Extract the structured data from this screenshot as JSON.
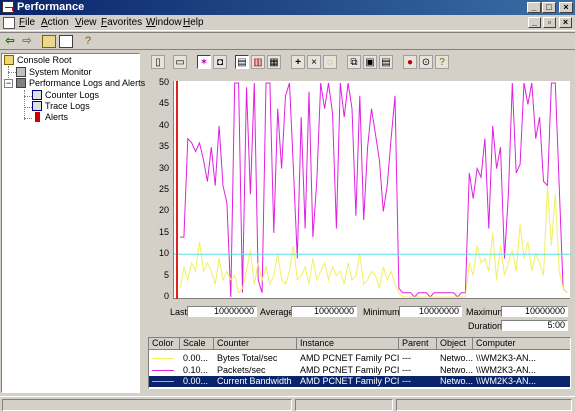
{
  "window": {
    "title": "Performance"
  },
  "menu": [
    "File",
    "Action",
    "View",
    "Favorites",
    "Window",
    "Help"
  ],
  "toolbar_icons": [
    "back-icon",
    "forward-icon",
    "up-folder-icon",
    "show-hide-tree-icon",
    "help-icon"
  ],
  "tree": [
    {
      "label": "Console Root",
      "icon": "folder-icon"
    },
    {
      "label": "System Monitor",
      "icon": "monitor-icon"
    },
    {
      "label": "Performance Logs and Alerts",
      "icon": "logs-icon"
    },
    {
      "label": "Counter Logs",
      "icon": "counter-log-icon"
    },
    {
      "label": "Trace Logs",
      "icon": "trace-log-icon"
    },
    {
      "label": "Alerts",
      "icon": "alert-icon"
    }
  ],
  "sysmon_toolbar": [
    "new-counter-set-icon",
    "clear-display-icon",
    "view-current-activity-icon",
    "view-log-data-icon",
    "view-graph-icon",
    "view-histogram-icon",
    "view-report-icon",
    "add-icon",
    "delete-icon",
    "highlight-icon",
    "copy-properties-icon",
    "paste-counter-list-icon",
    "properties-icon",
    "freeze-display-icon",
    "update-data-icon",
    "help-icon"
  ],
  "stats": {
    "last_label": "Last",
    "last_value": "10000000",
    "average_label": "Average",
    "average_value": "10000000",
    "minimum_label": "Minimum",
    "minimum_value": "10000000",
    "maximum_label": "Maximum",
    "maximum_value": "10000000",
    "duration_label": "Duration",
    "duration_value": "5:00"
  },
  "legend": {
    "headers": [
      "Color",
      "Scale",
      "Counter",
      "Instance",
      "Parent",
      "Object",
      "Computer"
    ],
    "rows": [
      {
        "color": "#ffff80",
        "scale": "0.00...",
        "counter": "Bytes Total/sec",
        "instance": "AMD PCNET Family PCI Et...",
        "parent": "---",
        "object": "Netwo...",
        "computer": "\\\\WM2K3-AN..."
      },
      {
        "color": "#ff00ff",
        "scale": "0.10...",
        "counter": "Packets/sec",
        "instance": "AMD PCNET Family PCI Et...",
        "parent": "---",
        "object": "Netwo...",
        "computer": "\\\\WM2K3-AN..."
      },
      {
        "color": "#40e0d0",
        "scale": "0.00...",
        "counter": "Current Bandwidth",
        "instance": "AMD PCNET Family PCI Et...",
        "parent": "---",
        "object": "Netwo...",
        "computer": "\\\\WM2K3-AN..."
      }
    ]
  },
  "chart_data": {
    "type": "line",
    "ylim": [
      0,
      50
    ],
    "yticks": [
      0,
      5,
      10,
      15,
      20,
      25,
      30,
      35,
      40,
      45,
      50
    ],
    "grid": false,
    "series": [
      {
        "name": "Packets/sec",
        "color": "#e020e0",
        "values": [
          14,
          14,
          37,
          36,
          34,
          36,
          32,
          27,
          35,
          26,
          40,
          26,
          22,
          0,
          50,
          50,
          1,
          49,
          24,
          50,
          4,
          1,
          50,
          50,
          15,
          44,
          30,
          47,
          50,
          30,
          9,
          42,
          16,
          48,
          14,
          27,
          50,
          44,
          50,
          43,
          16,
          50,
          42,
          50,
          44,
          19,
          47,
          18,
          35,
          44,
          38,
          32,
          20,
          26,
          37,
          47,
          2,
          1,
          1,
          1,
          0,
          1,
          1,
          1,
          0,
          1,
          1,
          1,
          1,
          1,
          1,
          0,
          1,
          1,
          29,
          23,
          30,
          28,
          37,
          16,
          40,
          30,
          35,
          9,
          24,
          50,
          29,
          31,
          50,
          45,
          50,
          37,
          42,
          27,
          26,
          50,
          50,
          26,
          2,
          1
        ]
      },
      {
        "name": "Bytes Total/sec",
        "color": "#f0f060",
        "values": [
          2,
          7,
          4,
          8,
          6,
          13,
          6,
          8,
          6,
          3,
          9,
          4,
          6,
          4,
          5,
          1,
          2,
          6,
          11,
          3,
          8,
          4,
          7,
          3,
          5,
          10,
          4,
          3,
          6,
          12,
          4,
          5,
          7,
          3,
          9,
          4,
          6,
          8,
          4,
          7,
          5,
          6,
          3,
          8,
          4,
          5,
          10,
          3,
          4,
          6,
          5,
          2,
          7,
          4,
          6,
          3,
          1,
          0,
          0,
          0,
          0,
          0,
          0,
          0,
          0,
          0,
          0,
          0,
          0,
          0,
          0,
          0,
          0,
          0,
          8,
          5,
          12,
          8,
          9,
          6,
          15,
          4,
          12,
          5,
          8,
          11,
          6,
          17,
          9,
          13,
          6,
          10,
          8,
          5,
          26,
          12,
          24,
          6,
          2,
          1
        ]
      },
      {
        "name": "Current Bandwidth",
        "color": "#60e0e0",
        "values_constant": 10
      }
    ]
  }
}
